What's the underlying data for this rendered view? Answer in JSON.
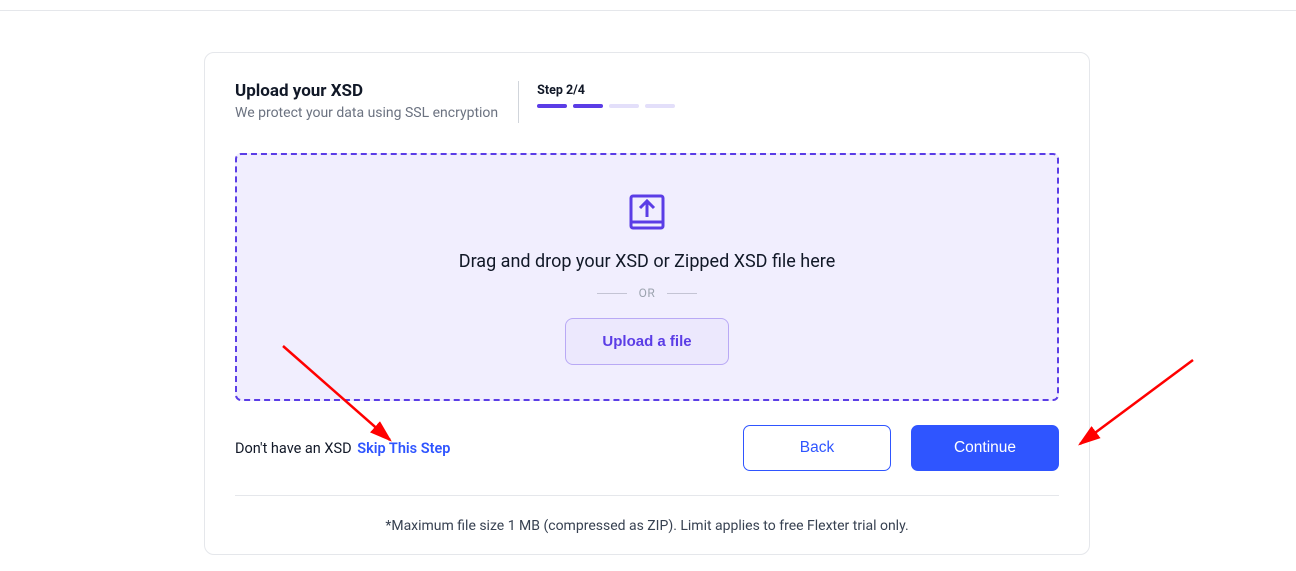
{
  "header": {
    "title": "Upload your XSD",
    "subtitle": "We protect your data using SSL encryption",
    "step_label": "Step 2/4",
    "progress_total": 4,
    "progress_filled": 2
  },
  "dropzone": {
    "instruction": "Drag and drop your XSD or Zipped XSD file here",
    "or_separator": "OR",
    "upload_button_label": "Upload a file"
  },
  "footer": {
    "skip_prefix": "Don't have an XSD",
    "skip_link_label": "Skip This Step",
    "back_label": "Back",
    "continue_label": "Continue"
  },
  "note": "*Maximum file size 1 MB (compressed as ZIP). Limit applies to free Flexter trial only.",
  "colors": {
    "accent_purple": "#5b3de6",
    "accent_blue": "#2f55ff",
    "dropzone_bg": "#f1eefe",
    "annotation_red": "#ff0000"
  }
}
